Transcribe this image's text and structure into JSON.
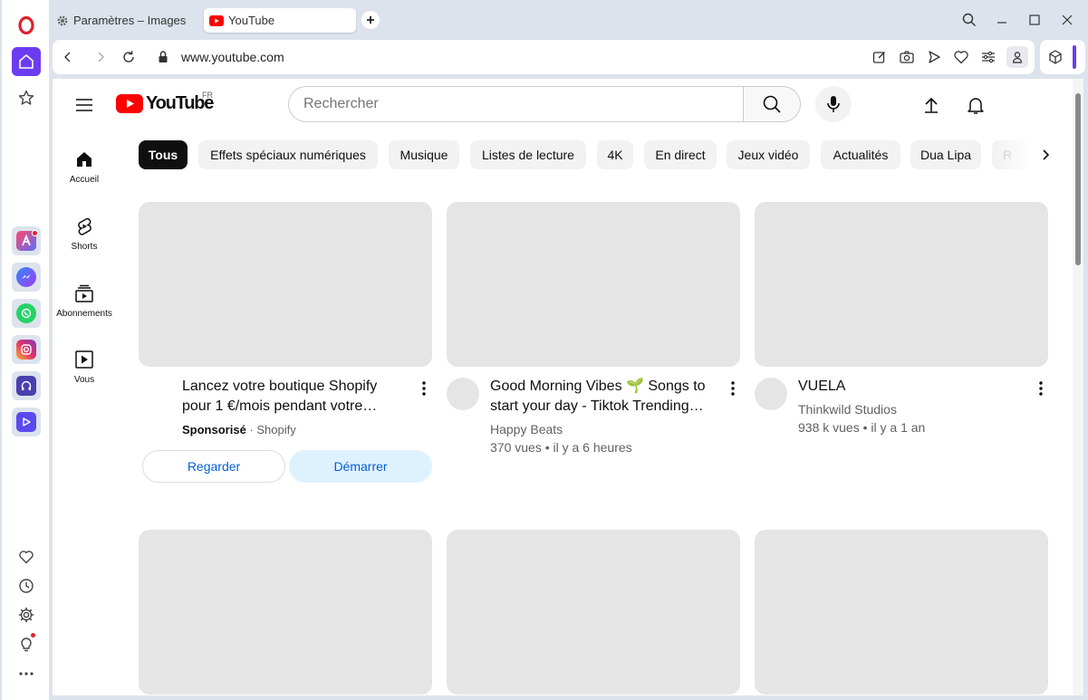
{
  "browser": {
    "tabs": [
      {
        "label": "Paramètres – Images"
      },
      {
        "label": "YouTube"
      }
    ],
    "url": "www.youtube.com"
  },
  "youtube": {
    "country": "FR",
    "logo_word": "YouTube",
    "search_placeholder": "Rechercher",
    "guide": [
      {
        "label": "Accueil"
      },
      {
        "label": "Shorts"
      },
      {
        "label": "Abonnements"
      },
      {
        "label": "Vous"
      }
    ],
    "chips": [
      {
        "label": "Tous"
      },
      {
        "label": "Effets spéciaux numériques"
      },
      {
        "label": "Musique"
      },
      {
        "label": "Listes de lecture"
      },
      {
        "label": "4K"
      },
      {
        "label": "En direct"
      },
      {
        "label": "Jeux vidéo"
      },
      {
        "label": "Actualités"
      },
      {
        "label": "Dua Lipa"
      },
      {
        "label": "R"
      }
    ],
    "videos": [
      {
        "title": "Lancez votre boutique Shopify pour 1 €/mois pendant votre…",
        "sponsored_label": "Sponsorisé",
        "advertiser": "· Shopify",
        "buttons": [
          "Regarder",
          "Démarrer"
        ]
      },
      {
        "title": "Good Morning Vibes 🌱 Songs to start your day - Tiktok Trending…",
        "channel": "Happy Beats",
        "meta": "370 vues • il y a 6 heures"
      },
      {
        "title": "VUELA",
        "channel": "Thinkwild Studios",
        "meta": "938 k vues • il y a 1 an"
      }
    ]
  },
  "colors": {
    "opera_red": "#e0202e",
    "opera_purple": "#6c3cf0",
    "youtube_red": "#ff0000",
    "link_blue": "#065fd4"
  }
}
